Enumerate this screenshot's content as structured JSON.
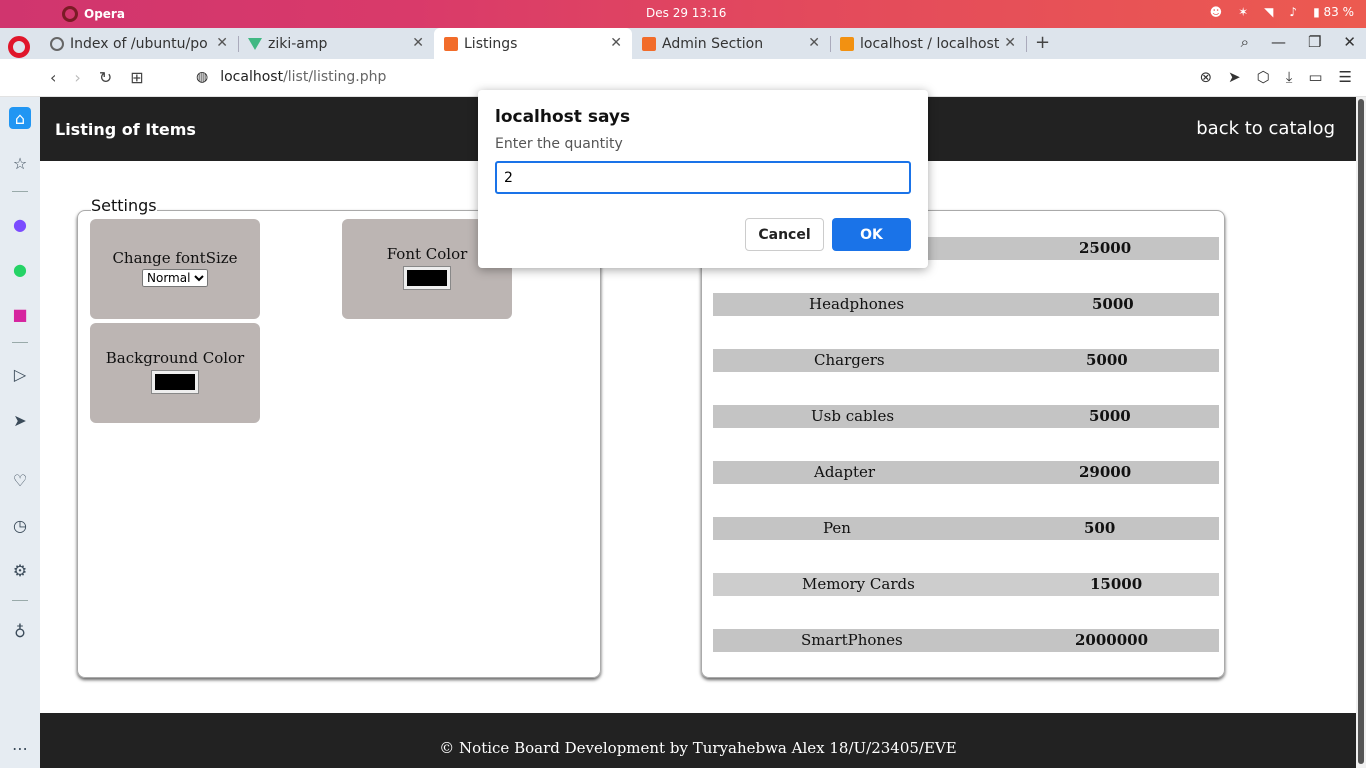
{
  "os": {
    "app_name": "Opera",
    "clock": "Des 29  13:16",
    "battery": "83 %"
  },
  "tabs": [
    {
      "title": "Index of /ubuntu/po",
      "favicon_color": "#888888"
    },
    {
      "title": "ziki-amp",
      "favicon_color": "#41b883"
    },
    {
      "title": "Listings",
      "favicon_color": "#f26c2a"
    },
    {
      "title": "Admin Section",
      "favicon_color": "#f26c2a"
    },
    {
      "title": "localhost / localhost",
      "favicon_color": "#f29111"
    }
  ],
  "address": {
    "host": "localhost",
    "path": "/list/listing.php"
  },
  "page": {
    "brand": "Listing of Items",
    "back_link": "back to catalog",
    "settings_title": "Settings",
    "font_size_label": "Change fontSize",
    "font_size_value": "Normal",
    "font_color_label": "Font Color",
    "font_color_value": "#000000",
    "bg_color_label": "Background Color",
    "bg_color_value": "#000000",
    "footer": "© Notice Board Development by Turyahebwa Alex 18/U/23405/EVE"
  },
  "items": [
    {
      "name": "",
      "price": "25000"
    },
    {
      "name": "Headphones",
      "price": "5000"
    },
    {
      "name": "Chargers",
      "price": "5000"
    },
    {
      "name": "Usb cables",
      "price": "5000"
    },
    {
      "name": "Adapter",
      "price": "29000"
    },
    {
      "name": "Pen",
      "price": "500"
    },
    {
      "name": "Memory Cards",
      "price": "15000"
    },
    {
      "name": "SmartPhones",
      "price": "2000000"
    }
  ],
  "dialog": {
    "title": "localhost says",
    "message": "Enter the quantity",
    "value": "2",
    "cancel_label": "Cancel",
    "ok_label": "OK"
  }
}
